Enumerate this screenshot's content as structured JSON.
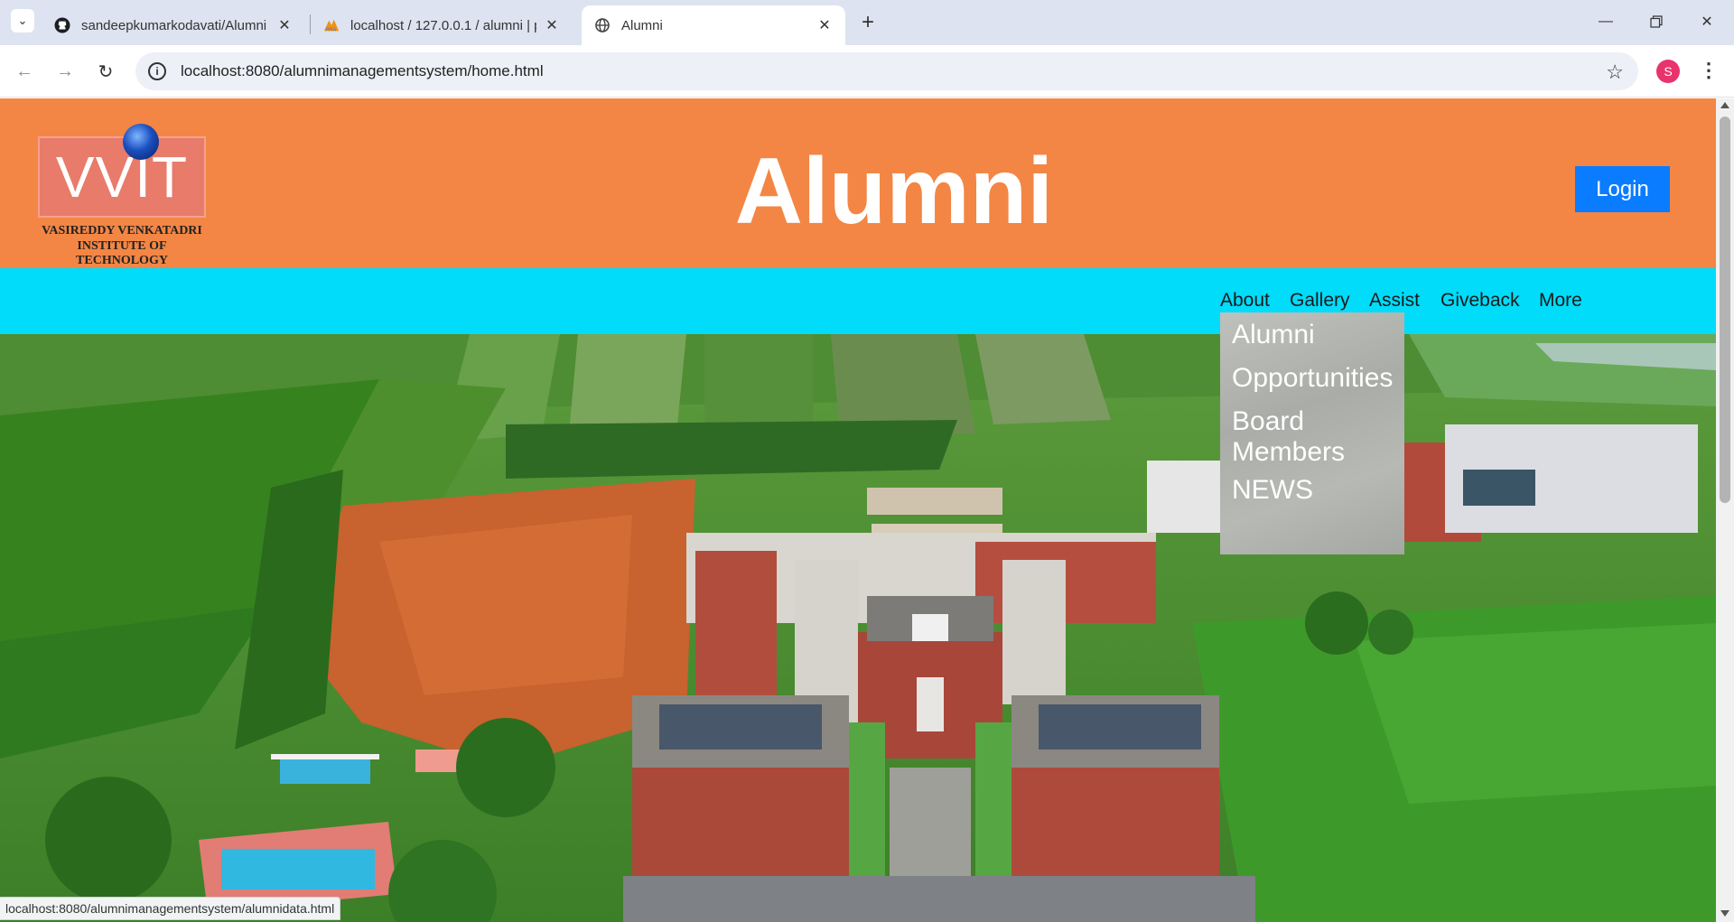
{
  "browser": {
    "tabs": [
      {
        "title": "sandeepkumarkodavati/Alumni",
        "icon": "github-icon",
        "active": false
      },
      {
        "title": "localhost / 127.0.0.1 / alumni | p",
        "icon": "phpmyadmin-icon",
        "active": false
      },
      {
        "title": "Alumni",
        "icon": "globe-icon",
        "active": true
      }
    ],
    "url": "localhost:8080/alumnimanagementsystem/home.html",
    "profile_initial": "S",
    "status_url": "localhost:8080/alumnimanagementsystem/alumnidata.html"
  },
  "header": {
    "logo_text": "VVIT",
    "logo_line1": "VASIREDDY VENKATADRI",
    "logo_line2": "INSTITUTE OF TECHNOLOGY",
    "title": "Alumni",
    "login_label": "Login"
  },
  "nav": {
    "items": [
      "About",
      "Gallery",
      "Assist",
      "Giveback",
      "More"
    ]
  },
  "dropdown": {
    "items": [
      "Alumni",
      "Opportunities",
      "Board Members",
      "NEWS"
    ]
  },
  "colors": {
    "header_bg": "#f38644",
    "nav_bg": "#00dcfa",
    "login_bg": "#0a7cff",
    "dropdown_bg": "#b0b2ad"
  }
}
